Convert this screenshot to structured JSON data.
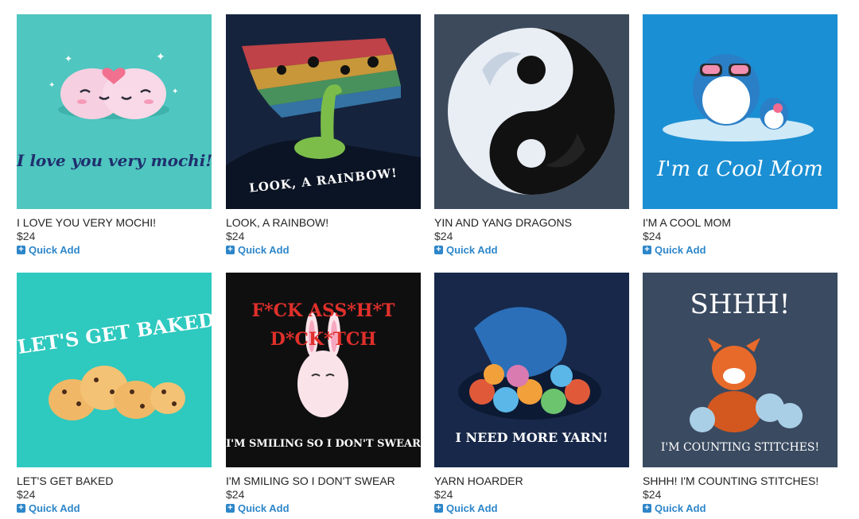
{
  "products": [
    {
      "title": "I LOVE YOU VERY MOCHI!",
      "price": "$24",
      "quick_add": "Quick Add",
      "art_text": "I love you very mochi!",
      "art_icon": "mochi-icon",
      "bg": "#4fc6bf"
    },
    {
      "title": "LOOK, A RAINBOW!",
      "price": "$24",
      "quick_add": "Quick Add",
      "art_text": "LOOK, A RAINBOW!",
      "art_icon": "dinosaur-icon",
      "bg": "#16233d"
    },
    {
      "title": "YIN AND YANG DRAGONS",
      "price": "$24",
      "quick_add": "Quick Add",
      "art_text": "",
      "art_icon": "yin-yang-dragons-icon",
      "bg": "#3c4a5c"
    },
    {
      "title": "I'M A COOL MOM",
      "price": "$24",
      "quick_add": "Quick Add",
      "art_text": "I'm a Cool Mom",
      "art_icon": "penguin-icon",
      "bg": "#1b8fd3"
    },
    {
      "title": "LET'S GET BAKED",
      "price": "$24",
      "quick_add": "Quick Add",
      "art_text": "LET'S GET BAKED!",
      "art_icon": "cookie-icon",
      "bg": "#2ec9bf"
    },
    {
      "title": "I'M SMILING SO I DON'T SWEAR",
      "price": "$24",
      "quick_add": "Quick Add",
      "art_text": "I'M SMILING SO I DON'T SWEAR",
      "art_icon": "bunny-icon",
      "bg": "#0f0f10"
    },
    {
      "title": "YARN HOARDER",
      "price": "$24",
      "quick_add": "Quick Add",
      "art_text": "I NEED MORE YARN!",
      "art_icon": "yarn-dragon-icon",
      "bg": "#17284a"
    },
    {
      "title": "SHHH! I'M COUNTING STITCHES!",
      "price": "$24",
      "quick_add": "Quick Add",
      "art_text": "I'M COUNTING STITCHES!",
      "art_icon": "red-panda-icon",
      "bg": "#3a4a60"
    }
  ],
  "art_extra": {
    "shhh": "SHHH!",
    "fck": "F*CK ASS*H*T D*CK*TCH"
  }
}
